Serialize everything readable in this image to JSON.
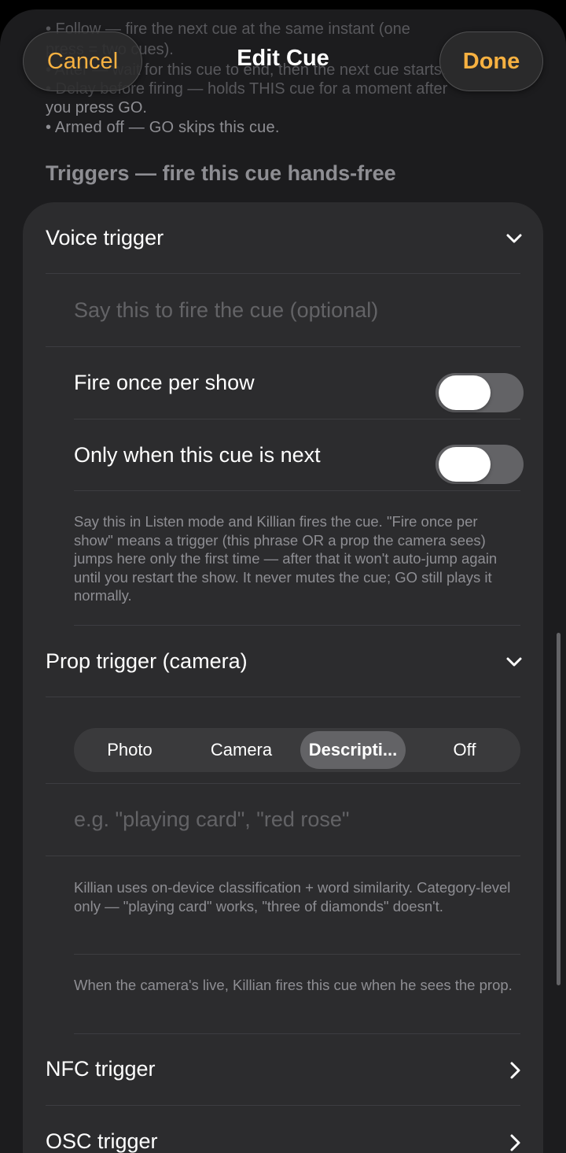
{
  "nav": {
    "cancel_label": "Cancel",
    "title": "Edit Cue",
    "done_label": "Done"
  },
  "help_top": {
    "line1": "• Follow — fire the next cue at the same instant (one",
    "line2": "press = two cues).",
    "line3": "• After — wait for this cue to end, then the next cue starts.",
    "line4": "• Delay before firing — holds THIS cue for a moment after",
    "line5": "you press GO.",
    "line6": "• Armed off — GO skips this cue."
  },
  "triggers": {
    "section_title": "Triggers — fire this cue hands-free",
    "voice": {
      "title": "Voice trigger",
      "phrase_placeholder": "Say this to fire the cue (optional)",
      "fire_once_label": "Fire once per show",
      "fire_once_on": false,
      "only_next_label": "Only when this cue is next",
      "only_next_on": false,
      "help": "Say this in Listen mode and Killian fires the cue. \"Fire once per show\" means a trigger (this phrase OR a prop the camera sees) jumps here only the first time — after that it won't auto-jump again until you restart the show. It never mutes the cue; GO still plays it normally."
    },
    "prop": {
      "title": "Prop trigger (camera)",
      "modes": [
        "Photo",
        "Camera",
        "Descripti...",
        "Off"
      ],
      "selected_mode": "Descripti...",
      "description_placeholder": "e.g. \"playing card\", \"red rose\"",
      "help1": "Killian uses on-device classification + word similarity. Category-level only — \"playing card\" works, \"three of diamonds\" doesn't.",
      "help2": "When the camera's live, Killian fires this cue when he sees the prop."
    },
    "nfc": {
      "title": "NFC trigger"
    },
    "osc": {
      "title": "OSC trigger"
    }
  },
  "icons": {
    "expand": "chevron-down-icon",
    "navigate": "chevron-right-icon"
  },
  "colors": {
    "accent": "#f7b141",
    "background": "#1c1c1e",
    "card": "#2c2c2e",
    "secondary_text": "#8e8e93",
    "placeholder_text": "#636366",
    "toggle_off": "#636366"
  }
}
